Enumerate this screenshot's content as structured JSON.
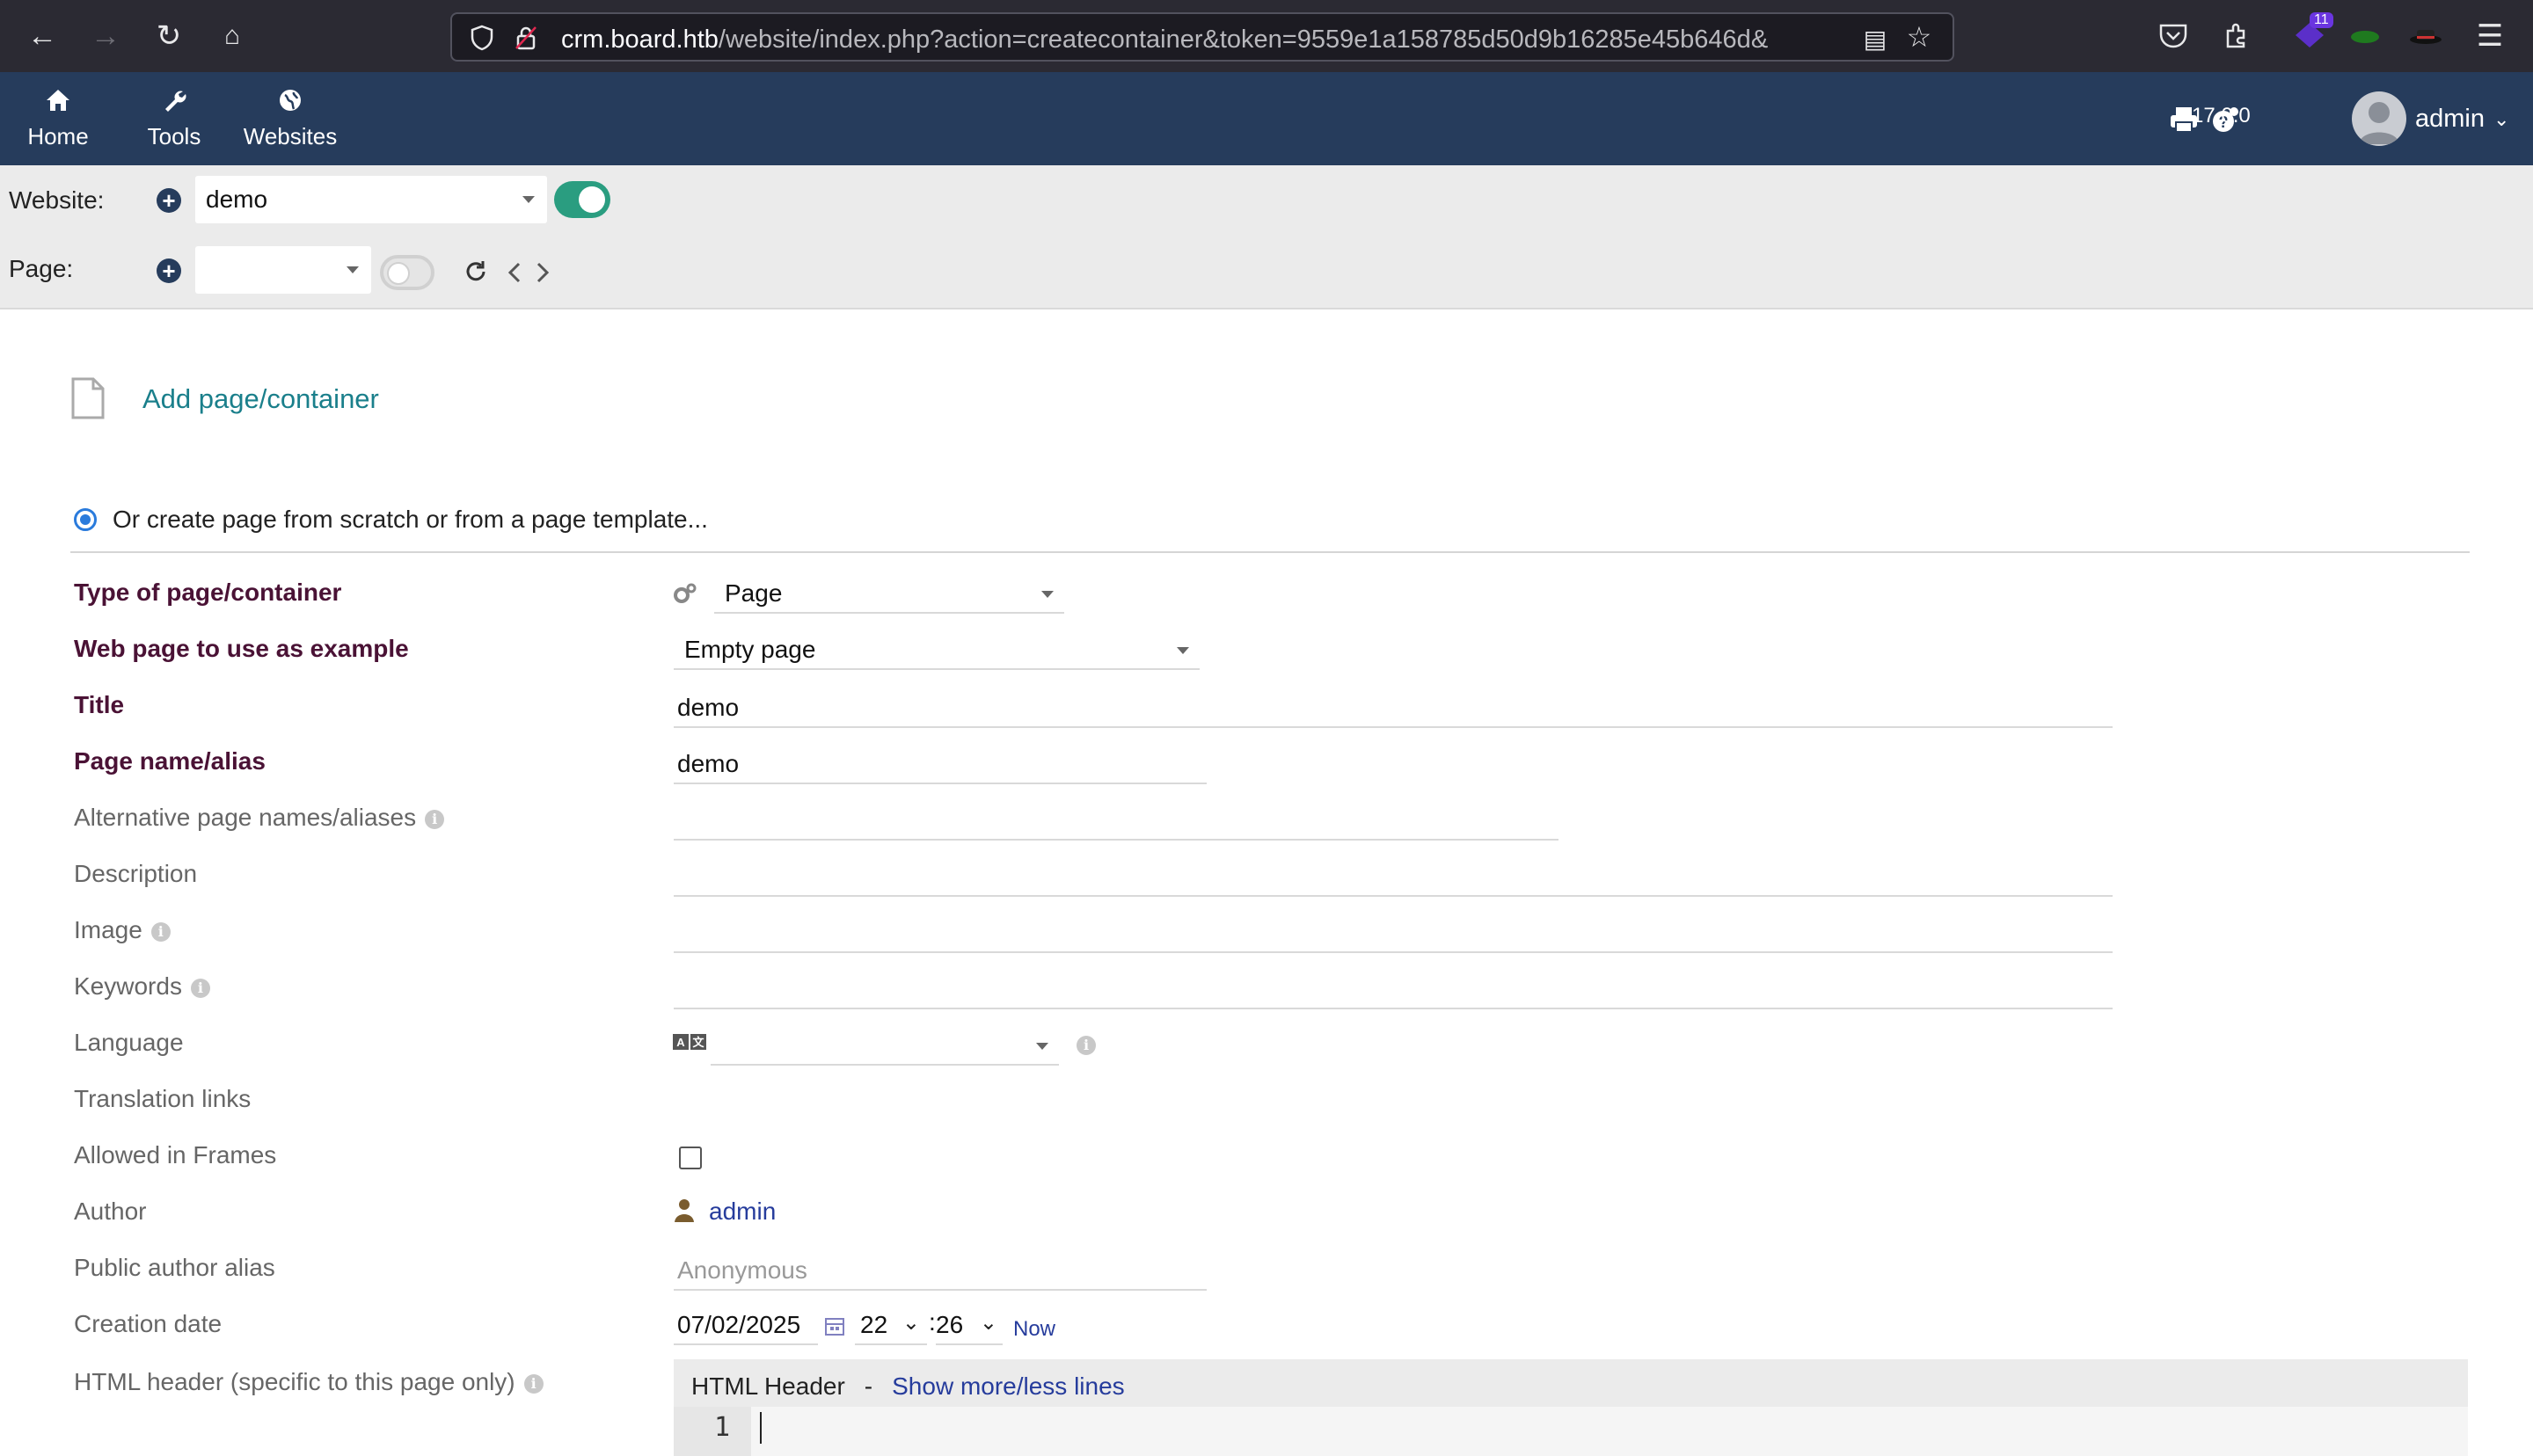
{
  "browser": {
    "url_host": "crm.board.htb",
    "url_path": "/website/index.php?action=createcontainer&token=9559e1a158785d50d9b16285e45b646d&",
    "badge_count": "11"
  },
  "header": {
    "menu": [
      {
        "label": "Home",
        "icon": "home-icon"
      },
      {
        "label": "Tools",
        "icon": "wrench-icon"
      },
      {
        "label": "Websites",
        "icon": "globe-icon"
      }
    ],
    "version": "17.0.0",
    "user": "admin"
  },
  "website_bar": {
    "label": "Website:",
    "value": "demo"
  },
  "page_bar": {
    "label": "Page:",
    "value": ""
  },
  "section": {
    "title": "Add page/container",
    "radio_label": "Or create page from scratch or from a page template..."
  },
  "form": {
    "type_label": "Type of page/container",
    "type_value": "Page",
    "example_label": "Web page to use as example",
    "example_value": "Empty page",
    "title_label": "Title",
    "title_value": "demo",
    "alias_label": "Page name/alias",
    "alias_value": "demo",
    "alt_alias_label": "Alternative page names/aliases",
    "alt_alias_value": "",
    "description_label": "Description",
    "description_value": "",
    "image_label": "Image",
    "image_value": "",
    "keywords_label": "Keywords",
    "keywords_value": "",
    "language_label": "Language",
    "language_value": "",
    "translation_label": "Translation links",
    "frames_label": "Allowed in Frames",
    "frames_checked": false,
    "author_label": "Author",
    "author_value": "admin",
    "public_alias_label": "Public author alias",
    "public_alias_placeholder": "Anonymous",
    "creation_label": "Creation date",
    "creation_date": "07/02/2025",
    "creation_hour": "22",
    "creation_minute": "26",
    "now_label": "Now",
    "html_header_label": "HTML header (specific to this page only)"
  },
  "editor": {
    "title": "HTML Header",
    "separator": "-",
    "toggle_link": "Show more/less lines",
    "first_line_number": "1"
  },
  "colors": {
    "header_bg": "#263c5c",
    "link": "#1a7f8b",
    "required_label": "#4a1235",
    "toggle_on": "#2a9d80"
  }
}
